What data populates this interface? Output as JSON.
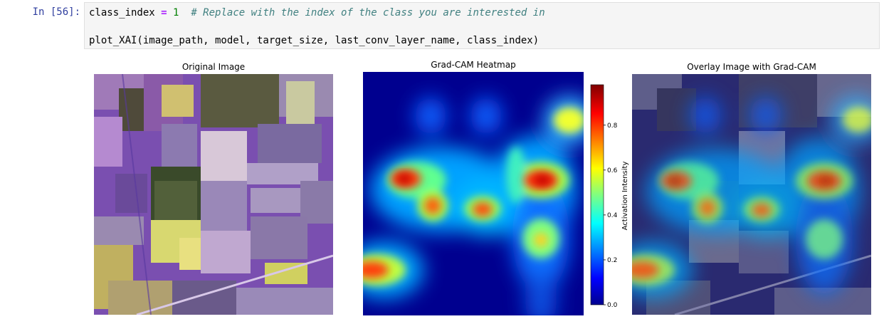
{
  "cell": {
    "prompt": "In [56]:",
    "line1": {
      "var": "class_index",
      "op": "=",
      "num": "1",
      "comment": "# Replace with the index of the class you are interested in"
    },
    "line2": "plot_XAI(image_path, model, target_size, last_conv_layer_name, class_index)"
  },
  "output": {
    "panels": [
      {
        "title": "Original Image",
        "kind": "satellite-image"
      },
      {
        "title": "Grad-CAM Heatmap",
        "kind": "heatmap"
      },
      {
        "title": "Overlay Image with Grad-CAM",
        "kind": "overlay-image"
      }
    ],
    "colorbar": {
      "label": "Activation Intensity",
      "ticks": [
        "0.0",
        "0.2",
        "0.4",
        "0.6",
        "0.8"
      ],
      "colormap": "jet",
      "range": [
        0.0,
        0.98
      ]
    }
  }
}
